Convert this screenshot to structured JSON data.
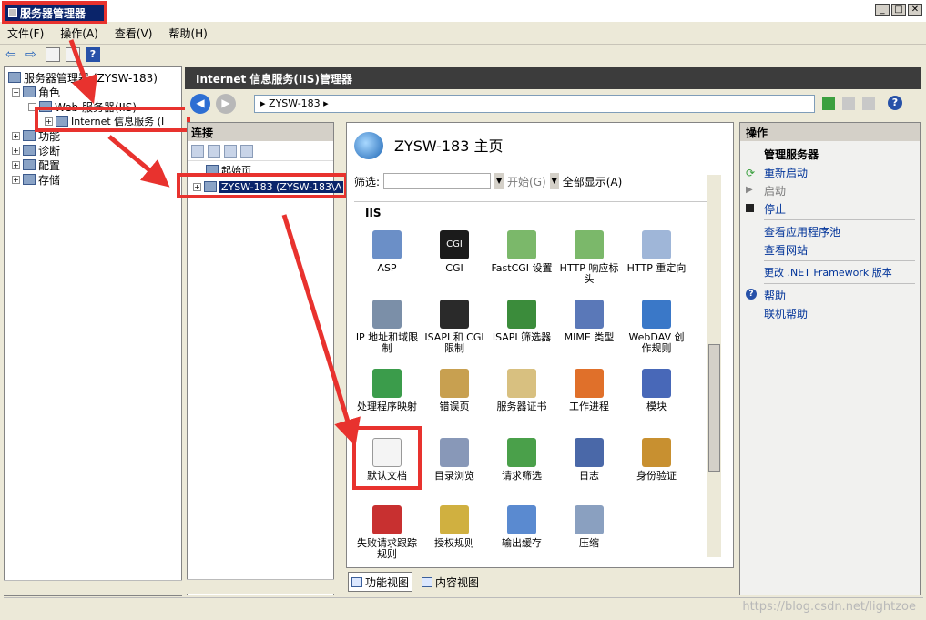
{
  "window": {
    "title": "服务器管理器"
  },
  "menu": [
    "文件(F)",
    "操作(A)",
    "查看(V)",
    "帮助(H)"
  ],
  "tree": [
    {
      "label": "服务器管理器 (ZYSW-183)",
      "indent": 0
    },
    {
      "label": "角色",
      "indent": 1
    },
    {
      "label": "Web 服务器(IIS)",
      "indent": 2
    },
    {
      "label": "Internet 信息服务 (I",
      "indent": 3
    },
    {
      "label": "功能",
      "indent": 1
    },
    {
      "label": "诊断",
      "indent": 1
    },
    {
      "label": "配置",
      "indent": 1
    },
    {
      "label": "存储",
      "indent": 1
    }
  ],
  "iis": {
    "header": "Internet 信息服务(IIS)管理器",
    "address": "ZYSW-183",
    "connections_title": "连接",
    "start_page": "起始页",
    "server_node": "ZYSW-183 (ZYSW-183\\A",
    "home_title": "ZYSW-183 主页",
    "filter_label": "筛选:",
    "start_label": "开始(G)",
    "show_all_label": "全部显示(A)",
    "section": "IIS",
    "view_tabs": [
      "功能视图",
      "内容视图"
    ]
  },
  "features": [
    {
      "label": "ASP",
      "color": "#6b8fc7"
    },
    {
      "label": "CGI",
      "color": "#1b1b1b"
    },
    {
      "label": "FastCGI 设置",
      "color": "#7bb86a"
    },
    {
      "label": "HTTP 响应标头",
      "color": "#7bb86a"
    },
    {
      "label": "HTTP 重定向",
      "color": "#9fb6d8"
    },
    {
      "label": "IP 地址和域限制",
      "color": "#7b8fa8"
    },
    {
      "label": "ISAPI 和 CGI 限制",
      "color": "#2a2a2a"
    },
    {
      "label": "ISAPI 筛选器",
      "color": "#3b8c3b"
    },
    {
      "label": "MIME 类型",
      "color": "#5a78b8"
    },
    {
      "label": "WebDAV 创作规则",
      "color": "#3a78c8"
    },
    {
      "label": "处理程序映射",
      "color": "#3b9c4b"
    },
    {
      "label": "错误页",
      "color": "#c8a050"
    },
    {
      "label": "服务器证书",
      "color": "#d8c080"
    },
    {
      "label": "工作进程",
      "color": "#e0702a"
    },
    {
      "label": "模块",
      "color": "#4868b8"
    },
    {
      "label": "默认文档",
      "color": "#e8e8e8"
    },
    {
      "label": "目录浏览",
      "color": "#8898b8"
    },
    {
      "label": "请求筛选",
      "color": "#4aa04a"
    },
    {
      "label": "日志",
      "color": "#4a68a8"
    },
    {
      "label": "身份验证",
      "color": "#c89030"
    },
    {
      "label": "失败请求跟踪规则",
      "color": "#c83030"
    },
    {
      "label": "授权规则",
      "color": "#d0b040"
    },
    {
      "label": "输出缓存",
      "color": "#5a8ad0"
    },
    {
      "label": "压缩",
      "color": "#8aa0c0"
    }
  ],
  "actions": {
    "title": "操作",
    "manage_server": "管理服务器",
    "restart": "重新启动",
    "start": "启动",
    "stop": "停止",
    "view_app_pools": "查看应用程序池",
    "view_sites": "查看网站",
    "change_net": "更改 .NET Framework 版本",
    "help": "帮助",
    "online_help": "联机帮助"
  },
  "watermark": "https://blog.csdn.net/lightzoe"
}
